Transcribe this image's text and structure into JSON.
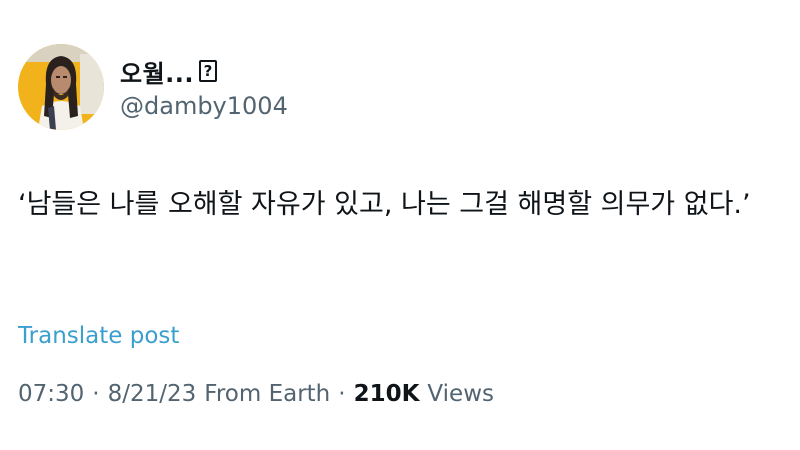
{
  "post": {
    "author": {
      "display_name": "오월...",
      "unknown_glyph": "?",
      "handle": "@damby1004"
    },
    "text": "‘남들은 나를 오해할 자유가 있고, 나는 그걸 해명할 의무가 없다.’",
    "translate_label": "Translate post",
    "meta": {
      "time": "07:30",
      "separator": "·",
      "date": "8/21/23",
      "source": "From Earth",
      "views_count": "210K",
      "views_label": "Views"
    }
  },
  "colors": {
    "text": "#0f1419",
    "secondary": "#536471",
    "link": "#3a9fce",
    "avatar_background": "#f2b21b"
  }
}
